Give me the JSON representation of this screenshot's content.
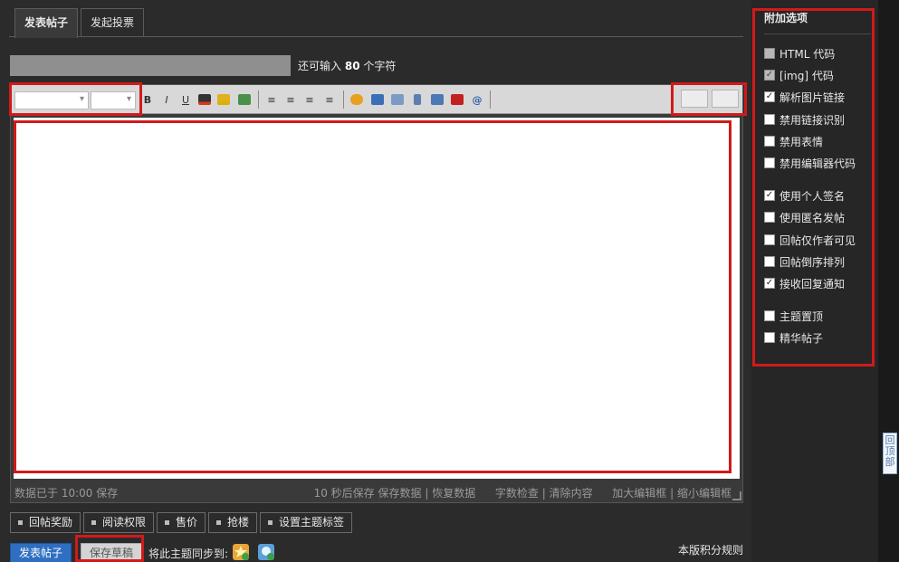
{
  "tabs": [
    {
      "label": "发表帖子",
      "active": true
    },
    {
      "label": "发起投票",
      "active": false
    }
  ],
  "title_counter": {
    "prefix": "还可输入",
    "count": "80",
    "suffix": "个字符"
  },
  "toolbar": {
    "font_select": "",
    "size_select": "",
    "icons": [
      "bold-icon",
      "italic-icon",
      "underline-icon",
      "font-color-icon",
      "background-color-icon",
      "link-icon",
      "align-left-icon",
      "align-center-icon",
      "align-right-icon",
      "float-icon",
      "smiley-icon",
      "image-icon",
      "attachment-icon",
      "code-icon",
      "quote-icon",
      "flash-icon",
      "at-icon"
    ]
  },
  "status_bar": {
    "saved": "数据已于 10:00 保存",
    "autosave": "10 秒后保存",
    "save_data": "保存数据",
    "restore_data": "恢复数据",
    "word_check": "字数检查",
    "clear_content": "清除内容",
    "enlarge": "加大编辑框",
    "shrink": "缩小编辑框",
    "sep": "|"
  },
  "extras": [
    "回帖奖励",
    "阅读权限",
    "售价",
    "抢楼",
    "设置主题标签"
  ],
  "bottom": {
    "submit": "发表帖子",
    "draft": "保存草稿",
    "sync": "将此主题同步到:",
    "rules": "本版积分规则"
  },
  "side": {
    "title": "附加选项",
    "options": [
      {
        "label": "HTML 代码",
        "checked": false,
        "disabled": true
      },
      {
        "label": "[img] 代码",
        "checked": true,
        "disabled": true
      },
      {
        "label": "解析图片链接",
        "checked": true,
        "disabled": false
      },
      {
        "label": "禁用链接识别",
        "checked": false,
        "disabled": false
      },
      {
        "label": "禁用表情",
        "checked": false,
        "disabled": false
      },
      {
        "label": "禁用编辑器代码",
        "checked": false,
        "disabled": false
      },
      {
        "label": "使用个人签名",
        "checked": true,
        "disabled": false
      },
      {
        "label": "使用匿名发帖",
        "checked": false,
        "disabled": false
      },
      {
        "label": "回帖仅作者可见",
        "checked": false,
        "disabled": false
      },
      {
        "label": "回帖倒序排列",
        "checked": false,
        "disabled": false
      },
      {
        "label": "接收回复通知",
        "checked": true,
        "disabled": false
      },
      {
        "label": "主题置顶",
        "checked": false,
        "disabled": false
      },
      {
        "label": "精华帖子",
        "checked": false,
        "disabled": false
      }
    ]
  },
  "back_to_top": "回顶部",
  "colors": {
    "highlight": "#d21a1a",
    "submit": "#2f6fc1",
    "page_bg": "#2b2b2b"
  }
}
